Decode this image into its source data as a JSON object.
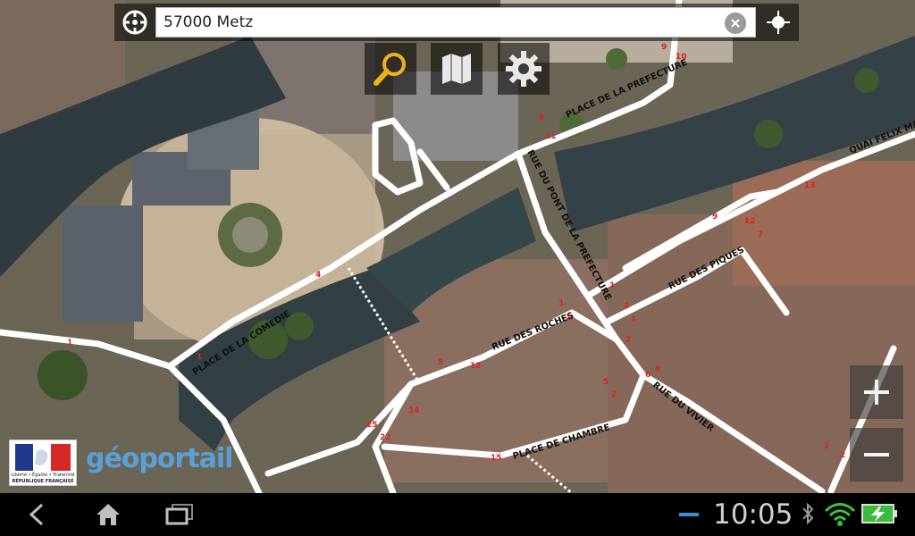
{
  "search": {
    "value": "57000 Metz",
    "placeholder": ""
  },
  "icons": {
    "crosshair": "crosshair-icon",
    "clear": "clear-icon",
    "locate": "locate-icon",
    "search": "search-icon",
    "layers": "map-layers-icon",
    "settings": "gear-icon",
    "zoom_in": "plus-icon",
    "zoom_out": "minus-icon"
  },
  "map_labels": {
    "place_prefecture": "PLACE DE LA PREFECTURE",
    "rue_pont_prefecture": "RUE DU PONT DE LA PREFECTURE",
    "quai_felix": "QUAI FELIX MARE",
    "place_comedie": "PLACE DE LA COMEDIE",
    "rue_roches": "RUE DES ROCHES",
    "rue_piques": "RUE DES PIQUES",
    "rue_vivier": "RUE DU VIVIER",
    "place_chambre": "PLACE DE CHAMBRE"
  },
  "house_numbers": [
    "9",
    "10",
    "8",
    "11",
    "13",
    "9",
    "12",
    "7",
    "1",
    "2",
    "1",
    "2",
    "1",
    "4",
    "1",
    "2",
    "5",
    "12",
    "14",
    "25",
    "22",
    "15",
    "5",
    "2",
    "6",
    "8",
    "1",
    "2",
    "2"
  ],
  "logos": {
    "republique_line1": "Liberté • Égalité • Fraternité",
    "republique_line2": "RÉPUBLIQUE FRANÇAISE",
    "geoportail": "géoportail"
  },
  "system": {
    "time": "10:05"
  }
}
